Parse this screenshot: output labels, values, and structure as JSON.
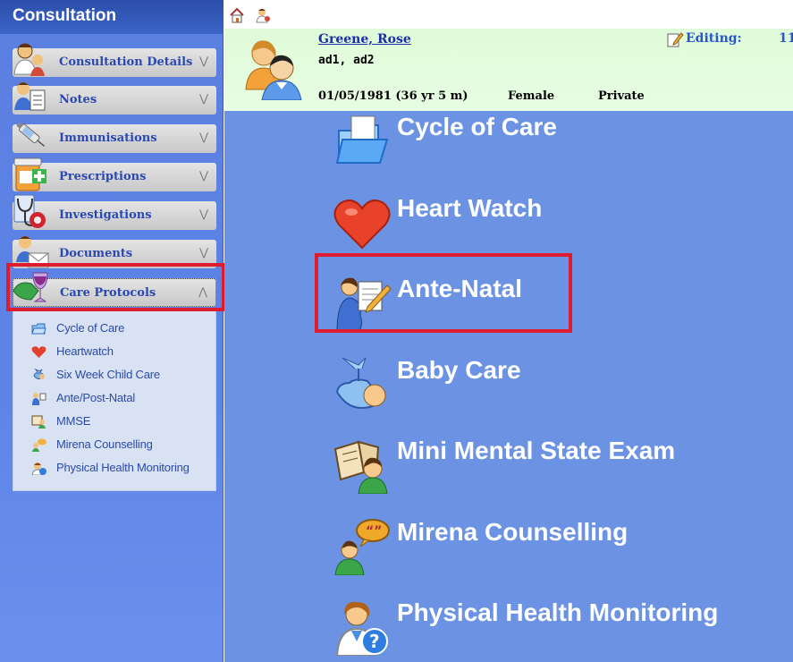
{
  "sidebar": {
    "title": "Consultation",
    "groups": [
      {
        "label": "Consultation Details",
        "icon": "doctor-patient-icon",
        "chevron": "expand"
      },
      {
        "label": "Notes",
        "icon": "notes-person-icon",
        "chevron": "expand"
      },
      {
        "label": "Immunisations",
        "icon": "syringe-icon",
        "chevron": "expand"
      },
      {
        "label": "Prescriptions",
        "icon": "prescription-bottle-icon",
        "chevron": "expand"
      },
      {
        "label": "Investigations",
        "icon": "stethoscope-icon",
        "chevron": "expand"
      },
      {
        "label": "Documents",
        "icon": "documents-person-icon",
        "chevron": "expand"
      },
      {
        "label": "Care Protocols",
        "icon": "care-protocols-icon",
        "chevron": "collapse",
        "selected": true
      }
    ],
    "care_protocols": [
      {
        "label": "Cycle of Care",
        "icon": "folder-icon"
      },
      {
        "label": "Heartwatch",
        "icon": "heart-icon"
      },
      {
        "label": "Six Week Child Care",
        "icon": "baby-icon"
      },
      {
        "label": "Ante/Post-Natal",
        "icon": "pregnancy-icon"
      },
      {
        "label": "MMSE",
        "icon": "mental-exam-icon"
      },
      {
        "label": "Mirena Counselling",
        "icon": "counselling-icon"
      },
      {
        "label": "Physical Health Monitoring",
        "icon": "health-monitor-icon"
      }
    ]
  },
  "patient": {
    "name": "Greene, Rose",
    "address": "ad1, ad2",
    "dob": "01/05/1981 (36 yr 5 m)",
    "sex": "Female",
    "billing": "Private",
    "editing_label": "Editing:",
    "editing_value": "11"
  },
  "main_menu": [
    {
      "label": "Cycle of Care",
      "icon": "folder-icon"
    },
    {
      "label": "Heart Watch",
      "icon": "heart-icon"
    },
    {
      "label": "Ante-Natal",
      "icon": "pregnancy-icon",
      "highlighted": true
    },
    {
      "label": "Baby Care",
      "icon": "baby-icon"
    },
    {
      "label": "Mini Mental State Exam",
      "icon": "mental-exam-icon"
    },
    {
      "label": "Mirena Counselling",
      "icon": "counselling-icon"
    },
    {
      "label": "Physical Health Monitoring",
      "icon": "health-monitor-icon"
    }
  ],
  "colors": {
    "sidebar": "#5e84e8",
    "main_bg": "#6c93e3",
    "patient_bg": "#dffbd9",
    "highlight": "#dd1c2d",
    "link": "#1b2ea8"
  }
}
